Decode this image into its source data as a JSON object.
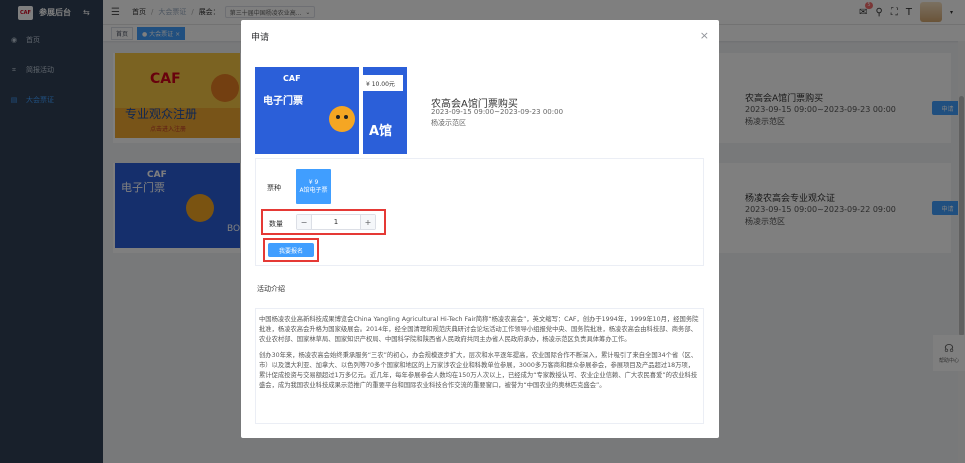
{
  "app": {
    "logo_text": "CAF",
    "title": "参展后台"
  },
  "sidebar": {
    "items": [
      {
        "label": "首页",
        "icon": "dashboard-icon"
      },
      {
        "label": "简报活动",
        "icon": "chart-icon"
      },
      {
        "label": "大会票证",
        "icon": "ticket-icon",
        "active": true
      }
    ]
  },
  "header": {
    "breadcrumb": {
      "home": "首页",
      "current": "大会票证",
      "session_label": "展会：",
      "session_value": "第三十届中国杨凌农业高..."
    },
    "message_count": "5"
  },
  "tags": {
    "home": "首页",
    "current": "大会票证"
  },
  "list": [
    {
      "title": "农高会A馆门票购买",
      "time": "2023-09-15 09:00~2023-09-23 00:00",
      "place": "杨凌示范区",
      "button": "申请",
      "banner_text": "专业观众注册",
      "banner_sub": "点击进入注册"
    },
    {
      "title": "杨凌农高会专业观众证",
      "time": "2023-09-15 09:00~2023-09-22 09:00",
      "place": "杨凌示范区",
      "button": "申请",
      "banner_text": "电子门票",
      "banner_sub": "BO"
    }
  ],
  "side_help": "帮助中心",
  "dialog": {
    "title": "申请",
    "close": "×",
    "ticket": {
      "price": "¥ 10.00元",
      "name": "电子门票",
      "hall": "A馆"
    },
    "product": {
      "title": "农高会A馆门票购买",
      "time": "2023-09-15 09:00~2023-09-23 00:00",
      "place": "杨凌示范区"
    },
    "kind_label": "票种",
    "kind_option": {
      "price": "¥ 9",
      "name": "A馆电子票"
    },
    "qty_label": "数量",
    "qty_value": "1",
    "submit": "我要报名",
    "intro_label": "活动介绍",
    "intro_p1": "中国杨凌农业高新科技成果博览会China Yangling Agricultural Hi-Tech Fair简称“杨凌农高会”，英文缩写：CAF，创办于1994年，1999年10月，经国务院批准，杨凌农高会升格为国家级展会。2014年，经全国清理和规范庆典研讨会论坛活动工作领导小组报党中央、国务院批准，杨凌农高会由科技部、商务部、农业农村部、国家林草局、国家知识产权局、中国科学院和陕西省人民政府共同主办省人民政府承办，杨凌示范区负责具体筹办工作。",
    "intro_p2": "创办30年来，杨凌农高会始终秉承服务“三农”的初心，办会规模逐步扩大，层次和水平逐年提高，农业国际合作不断深入，累计吸引了来自全国34个省（区、市）以及澳大利亚、加拿大、以色列等70多个国家和地区的上万家涉农企业和科教单位参展，3000多万客商和群众参展参会，参展项目及产品超过18万项，累计促成投资与交易额超过1万多亿元。近几年，每年参展参会人数均在150万人次以上，已经成为“专家教授认可、农业企业信赖、广大农民喜爱”的农业科技盛会，成为我国农业科技成果示范推广的重要平台和国际农业科技合作交流的重要窗口，被誉为“中国农业的奥林匹克盛会”。"
  },
  "colors": {
    "primary": "#409eff",
    "sidebar": "#304156",
    "highlight": "#e53935"
  }
}
